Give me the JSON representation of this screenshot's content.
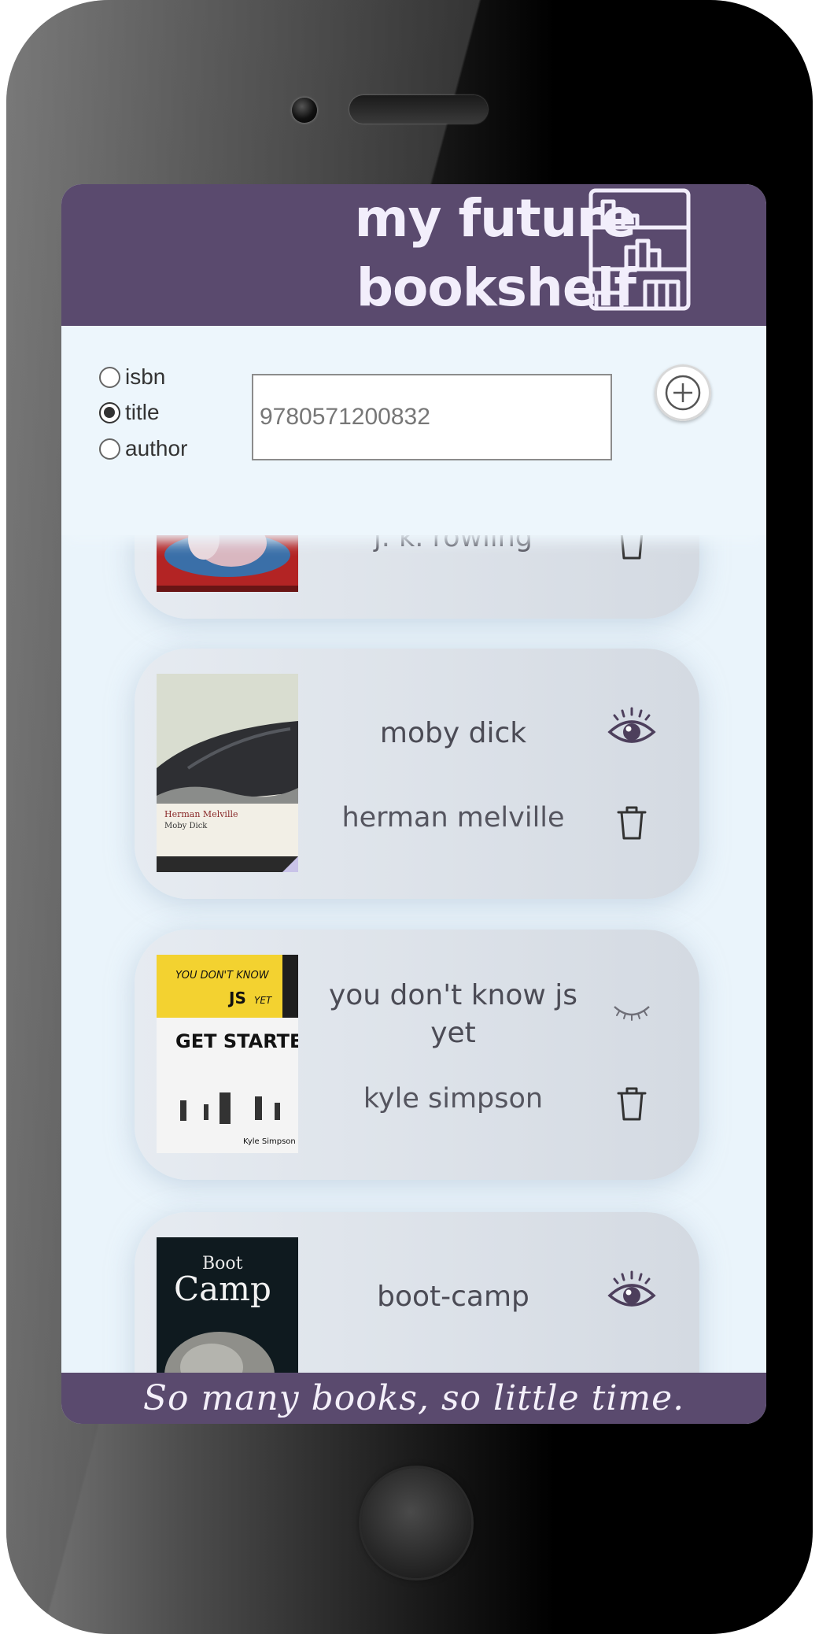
{
  "app": {
    "title_line1": "my future",
    "title_line2": "bookshelf",
    "logo_icon": "bookshelf-icon",
    "accent_color": "#5a4a6e"
  },
  "search": {
    "options": [
      {
        "label": "isbn",
        "checked": false
      },
      {
        "label": "title",
        "checked": true
      },
      {
        "label": "author",
        "checked": false
      }
    ],
    "query_value": "9780571200832",
    "add_icon": "plus-circle-icon"
  },
  "books": [
    {
      "title": "",
      "author": "j. k. rowling",
      "read_icon": "eye-open-icon",
      "delete_icon": "trash-icon"
    },
    {
      "title": "moby dick",
      "author": "herman melville",
      "read_icon": "eye-open-icon",
      "delete_icon": "trash-icon",
      "cover_text": "Herman Melville Moby Dick"
    },
    {
      "title": "you don't know js yet",
      "author": "kyle simpson",
      "read_icon": "eye-closed-icon",
      "delete_icon": "trash-icon",
      "cover_text": "YOU DON'T KNOW JS YET GET STARTED Kyle Simpson"
    },
    {
      "title": "boot-camp",
      "author": "",
      "read_icon": "eye-open-icon",
      "delete_icon": "trash-icon",
      "cover_text": "Boot Camp"
    }
  ],
  "footer": {
    "quote": "So many books, so little time."
  }
}
